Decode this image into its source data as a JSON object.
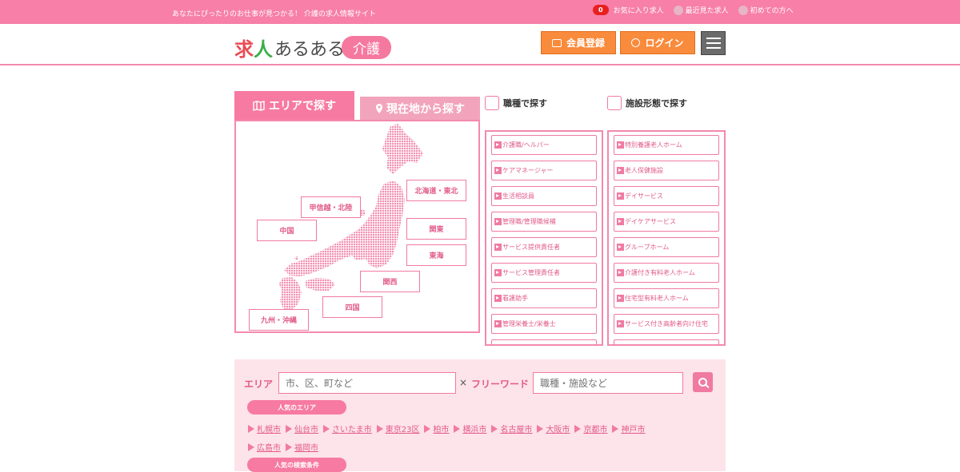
{
  "topbar": {
    "tagline": "あなたにぴったりのお仕事が見つかる！ 介護の求人情報サイト",
    "favorites_count": "0",
    "favorites_label": "お気に入り求人",
    "recent_label": "最近見た求人",
    "first_time_label": "初めての方へ"
  },
  "header": {
    "logo_kyu": "求",
    "logo_jin": "人",
    "logo_aru": "あるある",
    "logo_kaigo": "介護",
    "register_label": "会員登録",
    "login_label": "ログイン"
  },
  "area": {
    "tab_area": "エリアで探す",
    "tab_current": "現在地から探す",
    "regions": {
      "hokkaido": "北海道・東北",
      "koshinetsu": "甲信越・北陸",
      "chugoku": "中国",
      "kanto": "関東",
      "tokai": "東海",
      "kansai": "関西",
      "shikoku": "四国",
      "kyushu": "九州・沖縄"
    }
  },
  "jobs": {
    "title": "職種で探す",
    "items": [
      "介護職/ヘルパー",
      "ケアマネージャー",
      "生活相談員",
      "管理職/管理職候補",
      "サービス提供責任者",
      "サービス管理責任者",
      "看護助手",
      "管理栄養士/栄養士"
    ]
  },
  "facilities": {
    "title": "施設形態で探す",
    "items": [
      "特別養護老人ホーム",
      "老人保健施設",
      "デイサービス",
      "デイケアサービス",
      "グループホーム",
      "介護付き有料老人ホーム",
      "住宅型有料老人ホーム",
      "サービス付き高齢者向け住宅"
    ]
  },
  "search": {
    "area_label": "エリア",
    "area_placeholder": "市、区、町など",
    "times": "×",
    "freeword_label": "フリーワード",
    "freeword_placeholder": "職種・施設など",
    "popular_area_label": "人気のエリア",
    "cities_row1": [
      "札幌市",
      "仙台市",
      "さいたま市",
      "東京23区",
      "柏市",
      "横浜市",
      "名古屋市",
      "大阪市",
      "京都市",
      "神戸市"
    ],
    "cities_row2": [
      "広島市",
      "福岡市"
    ],
    "popular_cond_label": "人気の検索条件"
  },
  "colors": {
    "brand_pink": "#f77fa8",
    "accent_orange": "#f98b3c",
    "panel_bg": "#fde3ea"
  }
}
